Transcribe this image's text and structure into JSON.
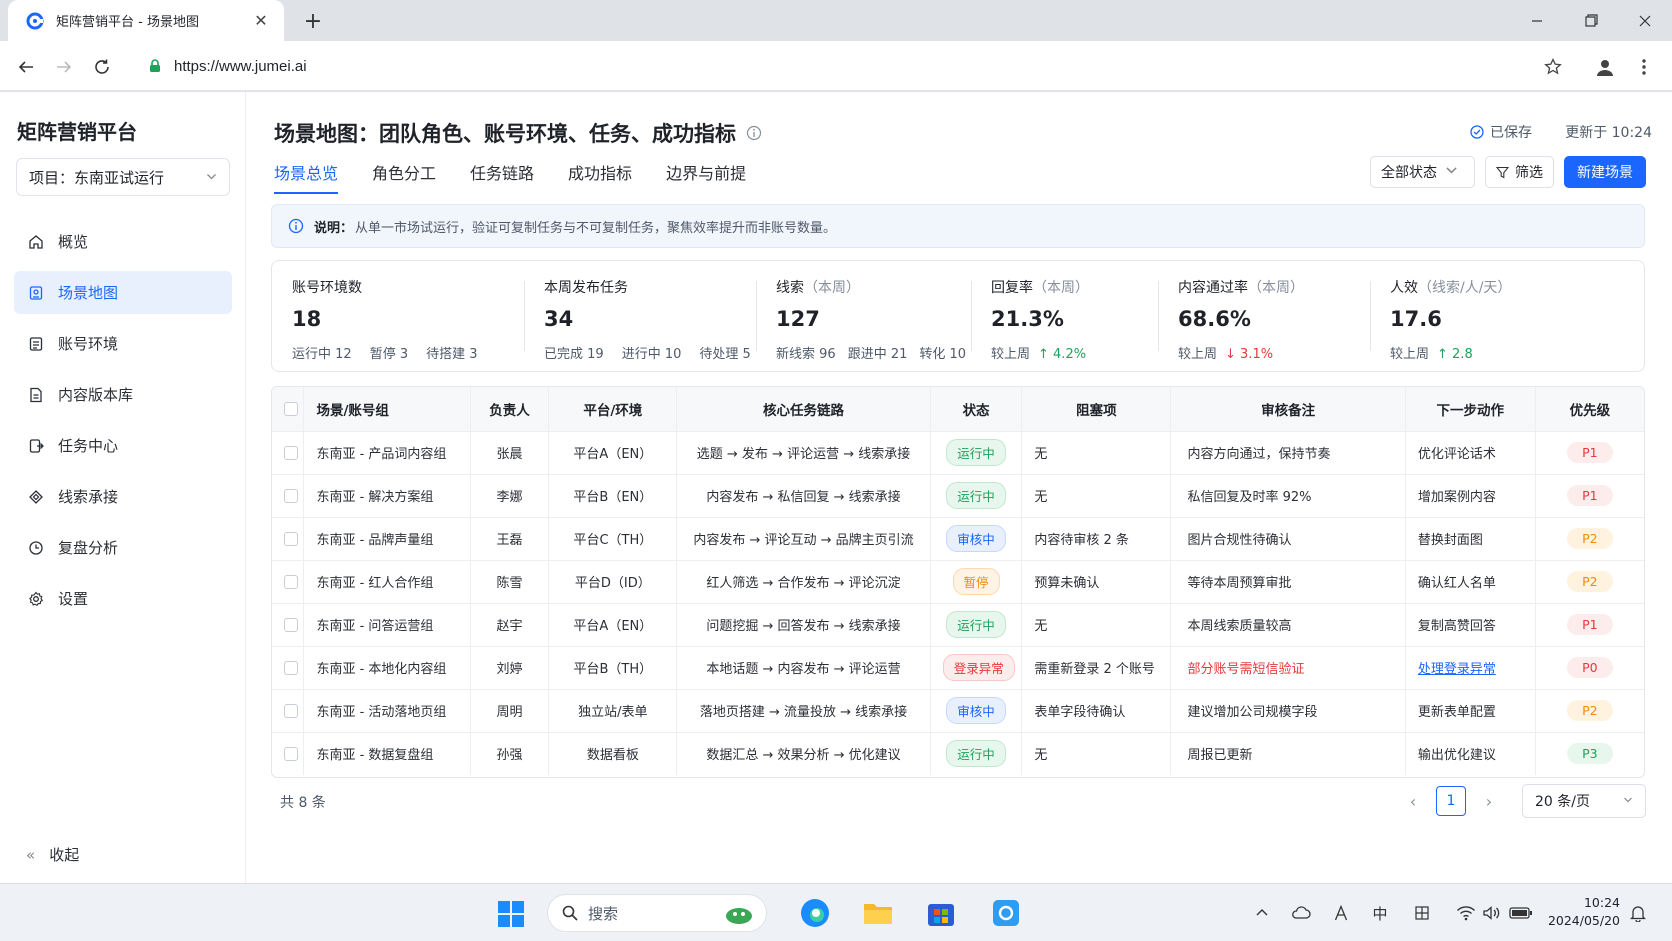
{
  "browser": {
    "tab_title": "矩阵营销平台 - 场景地图",
    "url": "https://www.jumei.ai"
  },
  "sidebar": {
    "brand": "矩阵营销平台",
    "project": "项目：东南亚试运行",
    "items": [
      {
        "label": "概览",
        "icon": "home-icon",
        "active": false
      },
      {
        "label": "场景地图",
        "icon": "map-icon",
        "active": true
      },
      {
        "label": "账号环境",
        "icon": "account-icon",
        "active": false
      },
      {
        "label": "内容版本库",
        "icon": "document-icon",
        "active": false
      },
      {
        "label": "任务中心",
        "icon": "task-icon",
        "active": false
      },
      {
        "label": "线索承接",
        "icon": "lead-icon",
        "active": false
      },
      {
        "label": "复盘分析",
        "icon": "analysis-icon",
        "active": false
      },
      {
        "label": "设置",
        "icon": "gear-icon",
        "active": false
      }
    ],
    "collapse": "收起"
  },
  "header": {
    "title": "场景地图：团队角色、账号环境、任务、成功指标",
    "saved": "已保存",
    "updated": "更新于 10:24"
  },
  "tabs": [
    "场景总览",
    "角色分工",
    "任务链路",
    "成功指标",
    "边界与前提"
  ],
  "toolbar": {
    "status_select": "全部状态",
    "filter": "筛选",
    "new_scene": "新建场景"
  },
  "notice": {
    "label": "说明：",
    "text": "从单一市场试运行，验证可复制任务与不可复制任务，聚焦效率提升而非账号数量。"
  },
  "stats": [
    {
      "label": "账号环境数",
      "sub_label": "",
      "value": "18",
      "details": [
        "运行中 12",
        "暂停 3",
        "待搭建 3"
      ],
      "trend": null
    },
    {
      "label": "本周发布任务",
      "sub_label": "",
      "value": "34",
      "details": [
        "已完成 19",
        "进行中 10",
        "待处理 5"
      ],
      "trend": null
    },
    {
      "label": "线索",
      "sub_label": "（本周）",
      "value": "127",
      "details": [
        "新线索 96",
        "跟进中 21",
        "转化 10"
      ],
      "trend": null
    },
    {
      "label": "回复率",
      "sub_label": "（本周）",
      "value": "21.3%",
      "details": [
        "较上周"
      ],
      "trend": {
        "dir": "up",
        "text": "↑ 4.2%"
      }
    },
    {
      "label": "内容通过率",
      "sub_label": "（本周）",
      "value": "68.6%",
      "details": [
        "较上周"
      ],
      "trend": {
        "dir": "down",
        "text": "↓ 3.1%"
      }
    },
    {
      "label": "人效",
      "sub_label": "（线索/人/天）",
      "value": "17.6",
      "details": [
        "较上周"
      ],
      "trend": {
        "dir": "up",
        "text": "↑ 2.8"
      }
    }
  ],
  "table": {
    "columns": [
      "场景/账号组",
      "负责人",
      "平台/环境",
      "核心任务链路",
      "状态",
      "阻塞项",
      "审核备注",
      "下一步动作",
      "优先级"
    ],
    "rows": [
      {
        "group": "东南亚 - 产品词内容组",
        "owner": "张晨",
        "platform": "平台A（EN）",
        "chain": "选题 → 发布 → 评论运营 → 线索承接",
        "status": "运行中",
        "status_type": "green",
        "blocker": "无",
        "review": "内容方向通过，保持节奏",
        "review_alert": false,
        "next": "优化评论话术",
        "next_link": false,
        "priority": "P1",
        "priority_type": "red"
      },
      {
        "group": "东南亚 - 解决方案组",
        "owner": "李娜",
        "platform": "平台B（EN）",
        "chain": "内容发布 → 私信回复 → 线索承接",
        "status": "运行中",
        "status_type": "green",
        "blocker": "无",
        "review": "私信回复及时率 92%",
        "review_alert": false,
        "next": "增加案例内容",
        "next_link": false,
        "priority": "P1",
        "priority_type": "red"
      },
      {
        "group": "东南亚 - 品牌声量组",
        "owner": "王磊",
        "platform": "平台C（TH）",
        "chain": "内容发布 → 评论互动 → 品牌主页引流",
        "status": "审核中",
        "status_type": "blue",
        "blocker": "内容待审核 2 条",
        "review": "图片合规性待确认",
        "review_alert": false,
        "next": "替换封面图",
        "next_link": false,
        "priority": "P2",
        "priority_type": "orange"
      },
      {
        "group": "东南亚 - 红人合作组",
        "owner": "陈雪",
        "platform": "平台D（ID）",
        "chain": "红人筛选 → 合作发布 → 评论沉淀",
        "status": "暂停",
        "status_type": "orange",
        "blocker": "预算未确认",
        "review": "等待本周预算审批",
        "review_alert": false,
        "next": "确认红人名单",
        "next_link": false,
        "priority": "P2",
        "priority_type": "orange"
      },
      {
        "group": "东南亚 - 问答运营组",
        "owner": "赵宇",
        "platform": "平台A（EN）",
        "chain": "问题挖掘 → 回答发布 → 线索承接",
        "status": "运行中",
        "status_type": "green",
        "blocker": "无",
        "review": "本周线索质量较高",
        "review_alert": false,
        "next": "复制高赞回答",
        "next_link": false,
        "priority": "P1",
        "priority_type": "red"
      },
      {
        "group": "东南亚 - 本地化内容组",
        "owner": "刘婷",
        "platform": "平台B（TH）",
        "chain": "本地话题 → 内容发布 → 评论运营",
        "status": "登录异常",
        "status_type": "red",
        "blocker": "需重新登录 2 个账号",
        "review": "部分账号需短信验证",
        "review_alert": true,
        "next": "处理登录异常",
        "next_link": true,
        "priority": "P0",
        "priority_type": "red"
      },
      {
        "group": "东南亚 - 活动落地页组",
        "owner": "周明",
        "platform": "独立站/表单",
        "chain": "落地页搭建 → 流量投放 → 线索承接",
        "status": "审核中",
        "status_type": "blue",
        "blocker": "表单字段待确认",
        "review": "建议增加公司规模字段",
        "review_alert": false,
        "next": "更新表单配置",
        "next_link": false,
        "priority": "P2",
        "priority_type": "orange"
      },
      {
        "group": "东南亚 - 数据复盘组",
        "owner": "孙强",
        "platform": "数据看板",
        "chain": "数据汇总 → 效果分析 → 优化建议",
        "status": "运行中",
        "status_type": "green",
        "blocker": "无",
        "review": "周报已更新",
        "review_alert": false,
        "next": "输出优化建议",
        "next_link": false,
        "priority": "P3",
        "priority_type": "green"
      }
    ]
  },
  "footer": {
    "total": "共 8 条",
    "page": "1",
    "page_size": "20 条/页"
  },
  "taskbar": {
    "search": "搜索",
    "ime": "中",
    "time": "10:24",
    "date": "2024/05/20"
  }
}
